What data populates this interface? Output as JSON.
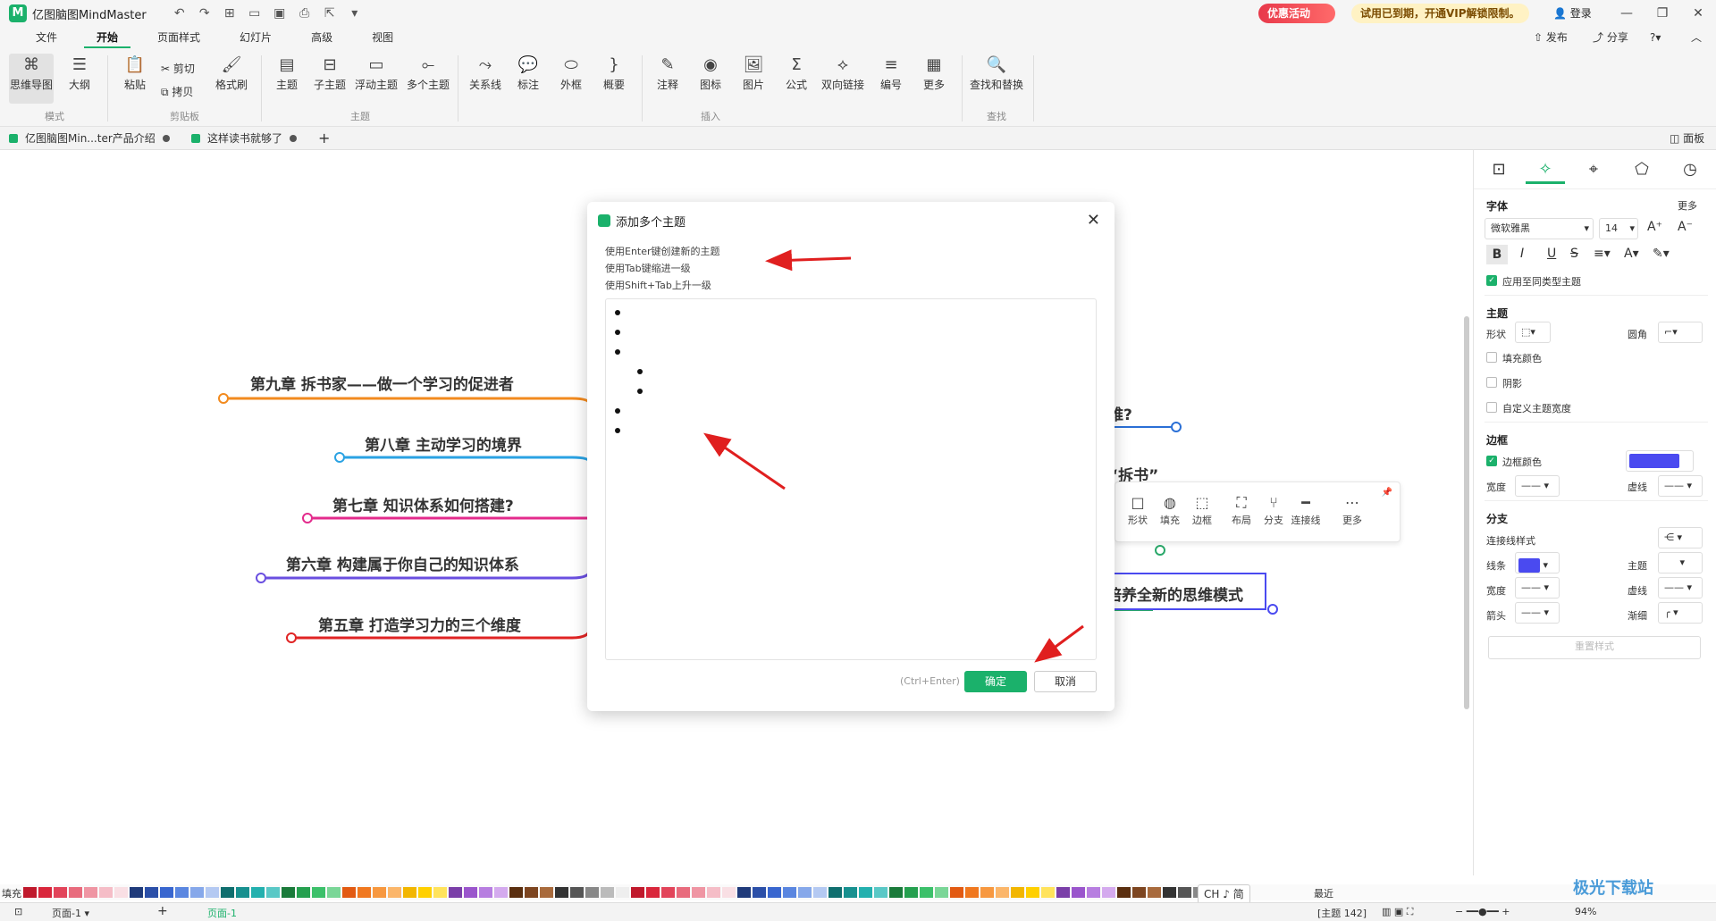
{
  "app": {
    "title": "亿图脑图MindMaster",
    "promo": "优惠活动",
    "vip_notice": "试用已到期，开通VIP解锁限制。",
    "login": "登录"
  },
  "menu": {
    "items": [
      "文件",
      "开始",
      "页面样式",
      "幻灯片",
      "高级",
      "视图"
    ],
    "active": "开始",
    "publish": "发布",
    "share": "分享"
  },
  "ribbon": {
    "mode": {
      "mindmap": "思维导图",
      "outline": "大纲",
      "group": "模式"
    },
    "clipboard": {
      "paste": "粘贴",
      "cut": "剪切",
      "copy": "拷贝",
      "format_painter": "格式刷",
      "group": "剪贴板"
    },
    "topic": {
      "topic": "主题",
      "subtopic": "子主题",
      "floating": "浮动主题",
      "multiple": "多个主题",
      "group": "主题"
    },
    "insert": {
      "relation": "关系线",
      "callout": "标注",
      "boundary": "外框",
      "summary": "概要",
      "note": "注释",
      "icon": "图标",
      "image": "图片",
      "formula": "公式",
      "bilink": "双向链接",
      "numbering": "编号",
      "more": "更多",
      "group": "插入"
    },
    "find": {
      "replace": "查找和替换",
      "group": "查找"
    }
  },
  "doc_tabs": {
    "tab1": "亿图脑图Min...ter产品介绍",
    "tab2": "这样读书就够了",
    "panel": "面板"
  },
  "canvas": {
    "topics": [
      "第九章 拆书家——做一个学习的促进者",
      "第八章 主动学习的境界",
      "第七章 知识体系如何搭建?",
      "第六章 构建属于你自己的知识体系",
      "第五章 打造学习力的三个维度"
    ],
    "right_topics": [
      "难?",
      "“拆书”",
      "培养全新的思维模式"
    ],
    "float_toolbar": [
      "形状",
      "填充",
      "边框",
      "布局",
      "分支",
      "连接线",
      "更多"
    ]
  },
  "dialog": {
    "title": "添加多个主题",
    "hints": [
      "使用Enter键创建新的主题",
      "使用Tab键缩进一级",
      "使用Shift+Tab上升一级"
    ],
    "shortcut": "(Ctrl+Enter)",
    "ok": "确定",
    "cancel": "取消"
  },
  "panel": {
    "font_title": "字体",
    "more": "更多",
    "font_name": "微软雅黑",
    "font_size": "14",
    "apply_same": "应用至同类型主题",
    "topic_title": "主题",
    "shape": "形状",
    "corner": "圆角",
    "fill_color": "填充颜色",
    "shadow": "阴影",
    "custom_width": "自定义主题宽度",
    "border_title": "边框",
    "border_color": "边框颜色",
    "width": "宽度",
    "dash": "虚线",
    "branch_title": "分支",
    "connector_style": "连接线样式",
    "line": "线条",
    "topic": "主题",
    "width2": "宽度",
    "dash2": "虚线",
    "arrow": "箭头",
    "taper": "渐细",
    "reset": "重置样式",
    "border_color_value": "#4a4af0"
  },
  "palette": {
    "fill_label": "填充",
    "recent_label": "最近"
  },
  "status": {
    "page": "页面-1",
    "page_tab": "页面-1",
    "topic_count": "[主题 142]",
    "zoom": "94%",
    "ime": "CH ♪ 简"
  },
  "watermark": "极光下载站"
}
